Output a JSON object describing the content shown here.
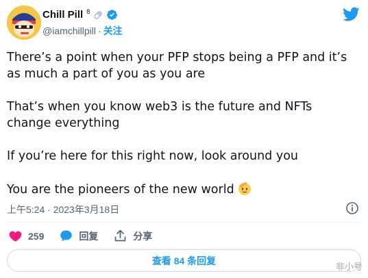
{
  "user": {
    "display_name": "Chill Pill",
    "superscript": "8",
    "handle": "@iamchillpill",
    "separator": "·",
    "follow_label": "关注"
  },
  "tweet": {
    "paragraphs": [
      "There’s a point when your PFP stops being a PFP and it’s as much a part of you as you are",
      "That’s when you know web3 is the future and NFTs change everything",
      "If you’re here for this right now, look around you",
      "You are the pioneers of the new world"
    ],
    "timestamp": "上午5:24 · 2023年3月18日"
  },
  "actions": {
    "like_count": "259",
    "reply_label": "回复",
    "share_label": "分享"
  },
  "replies_button_label": "查看 84 条回复",
  "watermark_text": "非小号",
  "icons": {
    "name_emoji": "pill-emoji",
    "verified": "verified-badge-icon",
    "logo": "twitter-bird-icon",
    "info": "info-icon",
    "like": "heart-icon",
    "reply": "speech-bubble-icon",
    "share": "share-icon",
    "text_emoji": "saluting-face-emoji"
  },
  "colors": {
    "accent": "#1d9bf0",
    "like": "#f91880",
    "text": "#0f1419",
    "muted": "#536471"
  }
}
